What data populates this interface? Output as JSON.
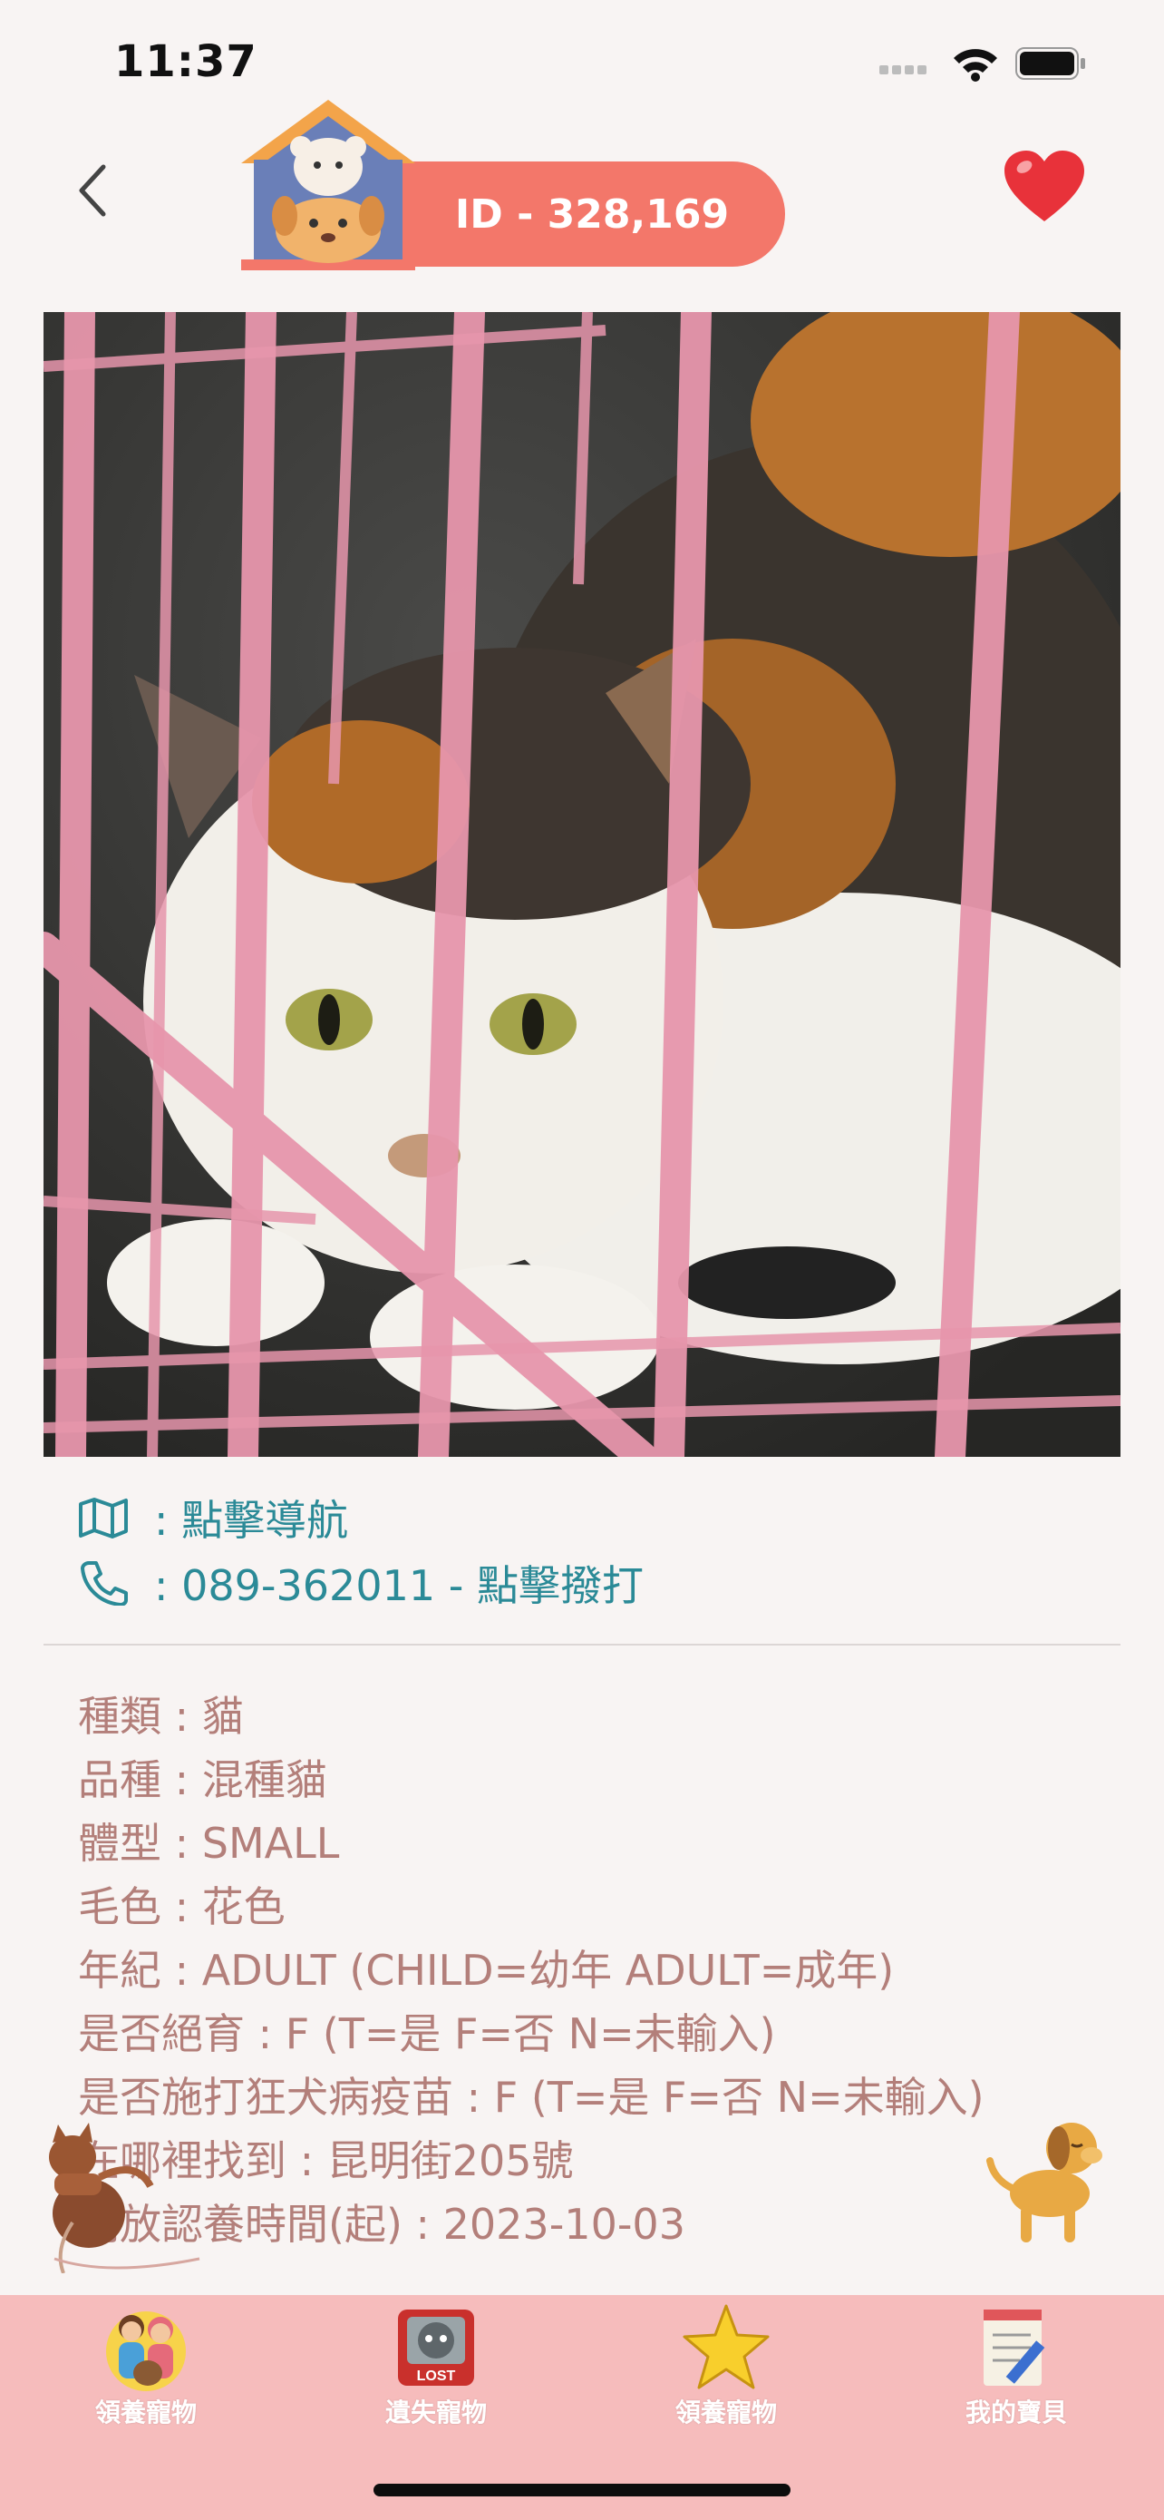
{
  "status_bar": {
    "time": "11:37"
  },
  "header": {
    "pet_id": "ID - 328,169"
  },
  "links": {
    "navigate": ": 點擊導航",
    "phone": ": 089-362011 - 點擊撥打"
  },
  "details": [
    "種類 : 貓",
    "品種 : 混種貓",
    "體型 : SMALL",
    "毛色 : 花色",
    "年紀 : ADULT (CHILD=幼年 ADULT=成年)",
    "是否絕育 : F (T=是 F=否 N=未輸入)",
    "是否施打狂犬病疫苗 : F (T=是 F=否 N=未輸入)",
    "在哪裡找到 : 昆明街205號",
    "開放認養時間(起) : 2023-10-03"
  ],
  "tabs": [
    {
      "label": "領養寵物",
      "icon": "family-pets-icon"
    },
    {
      "label": "遺失寵物",
      "icon": "lost-cat-icon"
    },
    {
      "label": "領養寵物",
      "icon": "star-icon"
    },
    {
      "label": "我的寶貝",
      "icon": "notepad-icon"
    }
  ],
  "colors": {
    "accent": "#f3776a",
    "link": "#2b8a97",
    "detail_text": "#b37f7a",
    "tabbar": "#f6bcbc",
    "background": "#f8f4f3"
  }
}
